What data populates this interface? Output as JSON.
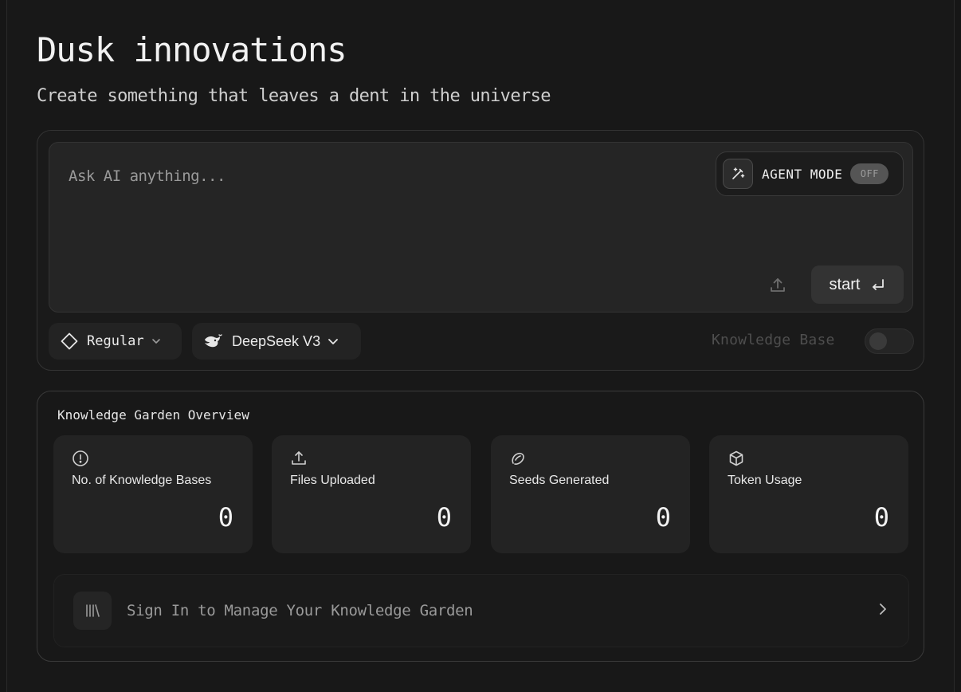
{
  "header": {
    "title": "Dusk innovations",
    "subtitle": "Create something that leaves a dent in the universe"
  },
  "prompt": {
    "placeholder": "Ask AI anything...",
    "value": "",
    "agent_mode": {
      "label": "AGENT MODE",
      "state": "OFF",
      "icon": "magic-wand-icon"
    },
    "upload_icon": "upload-icon",
    "start_label": "start",
    "start_icon": "enter-icon"
  },
  "controls": {
    "mode": {
      "label": "Regular",
      "icon": "diamond-icon"
    },
    "model": {
      "label": "DeepSeek V3",
      "icon": "deepseek-whale-icon"
    },
    "knowledge_base": {
      "label": "Knowledge Base",
      "enabled": false
    }
  },
  "garden": {
    "title": "Knowledge Garden Overview",
    "stats": [
      {
        "label": "No. of Knowledge Bases",
        "value": "0",
        "icon": "alert-circle-icon"
      },
      {
        "label": "Files Uploaded",
        "value": "0",
        "icon": "upload-icon"
      },
      {
        "label": "Seeds Generated",
        "value": "0",
        "icon": "seed-icon"
      },
      {
        "label": "Token Usage",
        "value": "0",
        "icon": "box-icon"
      }
    ],
    "signin": {
      "label": "Sign In to Manage Your Knowledge Garden",
      "icon": "library-icon"
    }
  },
  "colors": {
    "background": "#161616",
    "card": "#232323",
    "text": "#f2f2f2",
    "muted": "#9a9a9a"
  }
}
